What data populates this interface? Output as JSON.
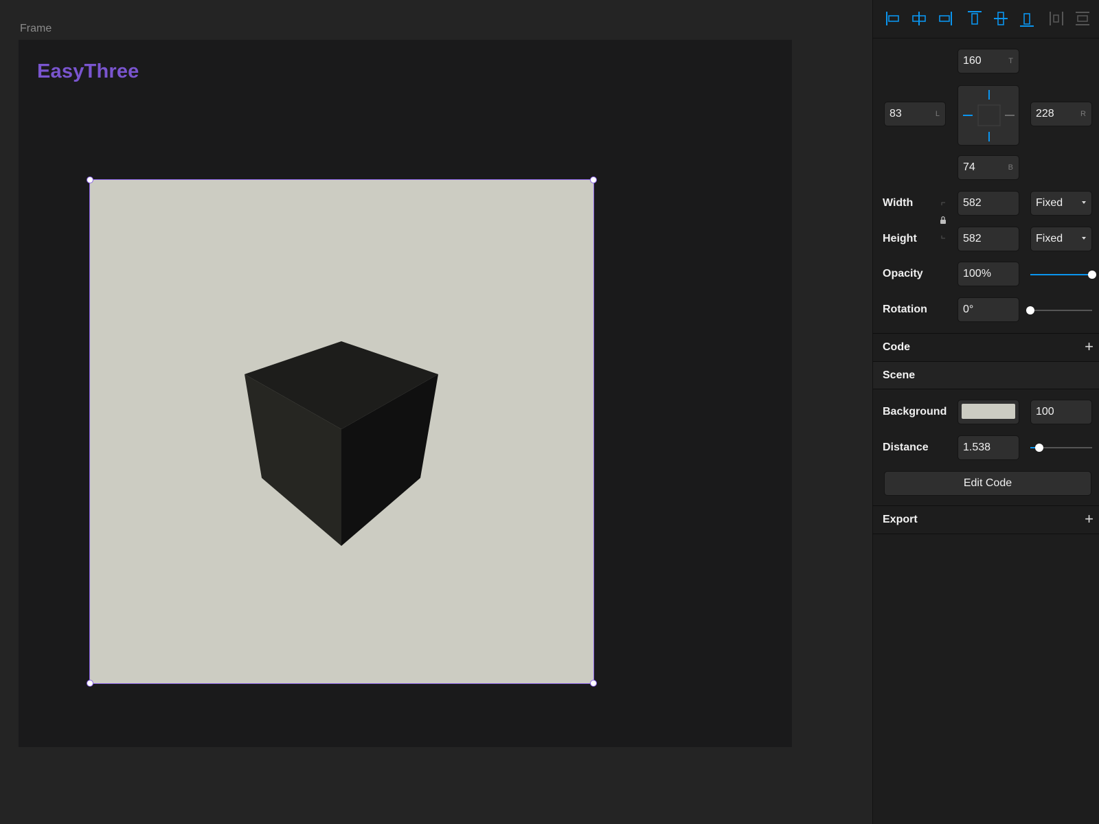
{
  "canvas": {
    "frame_label": "Frame",
    "brand": "EasyThree",
    "scene_background": "#ccccc2",
    "selection_color": "#8b63e8"
  },
  "panel": {
    "align_icons": [
      "align-left-icon",
      "align-horizontal-center-icon",
      "align-right-icon",
      "align-top-icon",
      "align-vertical-center-icon",
      "align-bottom-icon",
      "distribute-horizontal-icon",
      "distribute-vertical-icon"
    ],
    "position": {
      "top": {
        "value": "160",
        "suffix": "T"
      },
      "left": {
        "value": "83",
        "suffix": "L"
      },
      "right": {
        "value": "228",
        "suffix": "R"
      },
      "bottom": {
        "value": "74",
        "suffix": "B"
      }
    },
    "width": {
      "label": "Width",
      "value": "582",
      "mode": "Fixed"
    },
    "height": {
      "label": "Height",
      "value": "582",
      "mode": "Fixed"
    },
    "opacity": {
      "label": "Opacity",
      "value": "100%",
      "level": 1.0
    },
    "rotation": {
      "label": "Rotation",
      "value": "0°",
      "level": 0.0
    },
    "code_section": {
      "title": "Code",
      "add": "+"
    },
    "scene_section": {
      "title": "Scene",
      "background": {
        "label": "Background",
        "color": "#ccccc2",
        "value": "100"
      },
      "distance": {
        "label": "Distance",
        "value": "1.538",
        "level": 0.14
      },
      "edit_code": "Edit Code"
    },
    "export_section": {
      "title": "Export",
      "add": "+"
    },
    "accent": "#0a95ef"
  }
}
